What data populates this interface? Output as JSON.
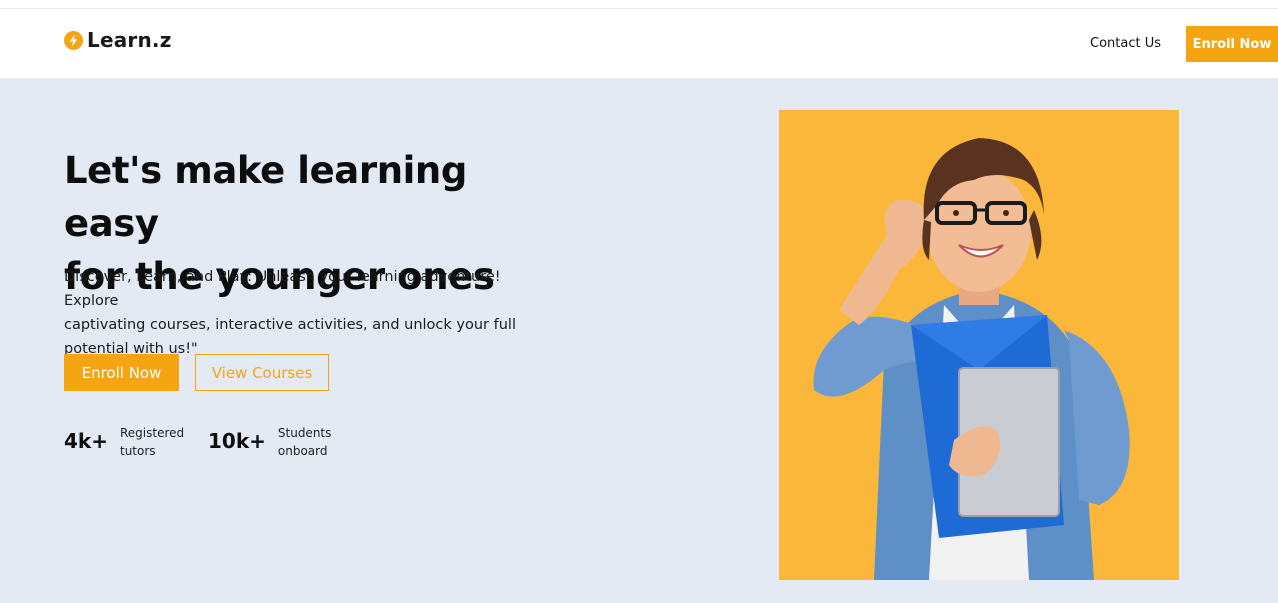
{
  "header": {
    "logo_text": "Learn.z",
    "nav": {
      "contact_label": "Contact Us",
      "enroll_label": "Enroll Now"
    }
  },
  "hero": {
    "title_line1": "Let's make learning easy",
    "title_line2": "for the younger ones",
    "description_line1": "Discover, Learn, and Play: Unleash your learning adventure! Explore",
    "description_line2": "captivating courses, interactive activities, and unlock your full",
    "description_line3": "potential with us!\"",
    "primary_button": "Enroll Now",
    "secondary_button": "View Courses",
    "stats": [
      {
        "value": "4k+",
        "label_line1": "Registered",
        "label_line2": "tutors"
      },
      {
        "value": "10k+",
        "label_line1": "Students",
        "label_line2": "onboard"
      }
    ]
  },
  "colors": {
    "accent": "#f5a511",
    "hero_background": "#e4eaf4",
    "image_background": "#fbb73a"
  },
  "icons": {
    "logo": "lightning-bolt-icon"
  }
}
